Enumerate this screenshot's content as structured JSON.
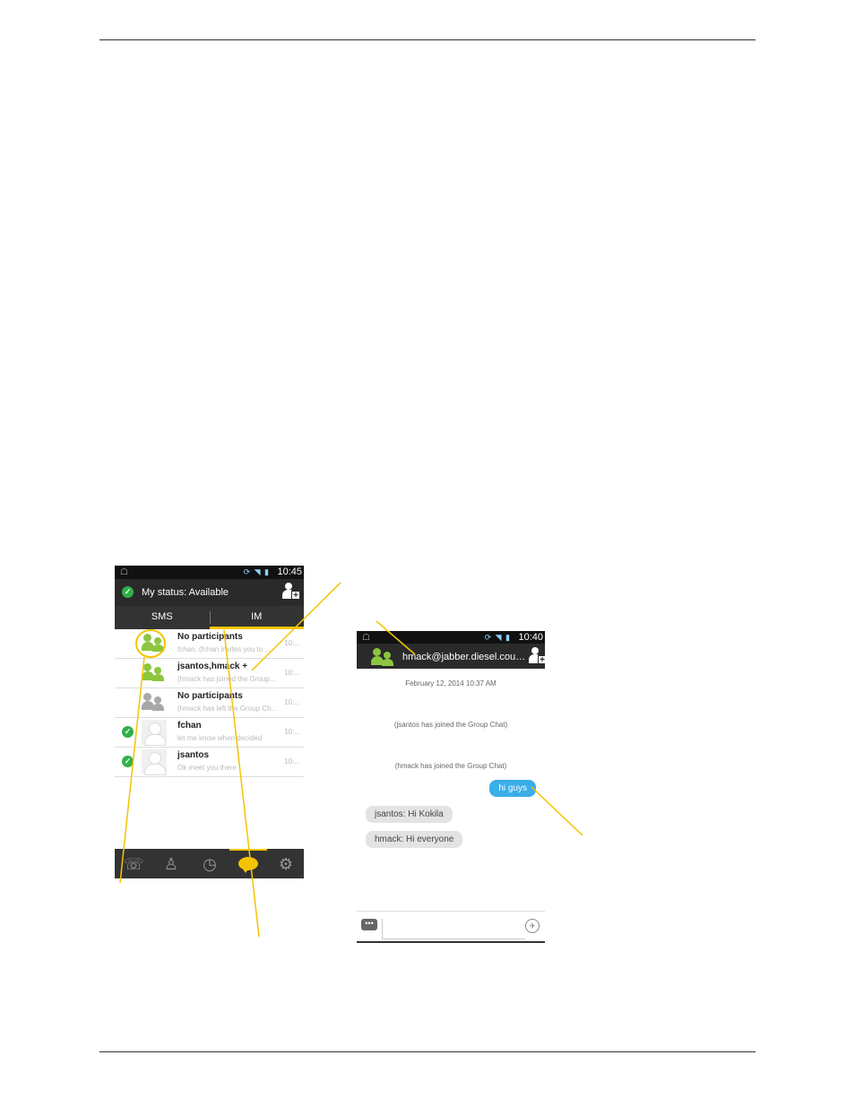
{
  "colors": {
    "accent": "#f5c400",
    "status_ok": "#31b04a",
    "group_online": "#8cc63f",
    "bubble_out": "#3aaee8"
  },
  "contacts_screen": {
    "status_bar": {
      "time": "10:45"
    },
    "header": {
      "status": "My status: Available",
      "add_contact_icon": "add-contact-icon"
    },
    "tabs": [
      {
        "label": "SMS"
      },
      {
        "label": "IM"
      }
    ],
    "active_tab": "IM",
    "conversations": [
      {
        "name": "No participants",
        "preview": "fchan: (fchan invites you to ...",
        "time": "10:...",
        "avatar": "group-green",
        "online": false
      },
      {
        "name": "jsantos,hmack +",
        "preview": "(hmack has joined the Group...",
        "time": "10:...",
        "avatar": "group-green",
        "online": false
      },
      {
        "name": "No participants",
        "preview": "(hmack has left the Group Ch...",
        "time": "10:...",
        "avatar": "group-gray",
        "online": false
      },
      {
        "name": "fchan",
        "preview": "let me know when decided",
        "time": "10:...",
        "avatar": "person",
        "online": true
      },
      {
        "name": "jsantos",
        "preview": "Ok meet you there",
        "time": "10:...",
        "avatar": "person",
        "online": true
      }
    ],
    "bottom_nav": [
      "phone-icon",
      "contacts-icon",
      "history-icon",
      "chat-icon",
      "settings-icon"
    ],
    "active_nav": "chat-icon"
  },
  "chat_screen": {
    "status_bar": {
      "time": "10:40"
    },
    "header": {
      "title": "hmack@jabber.diesel.count..."
    },
    "date": "February 12, 2014 10:37 AM",
    "system_messages": [
      "(jsantos has joined the Group Chat)",
      "(hmack has joined the Group Chat)"
    ],
    "outgoing": "hi guys",
    "incoming": [
      "jsantos: Hi Kokila",
      "hmack: Hi everyone"
    ],
    "compose": {
      "placeholder": "",
      "emoticon_icon": "emoticon-icon",
      "send_icon": "send-icon"
    }
  }
}
